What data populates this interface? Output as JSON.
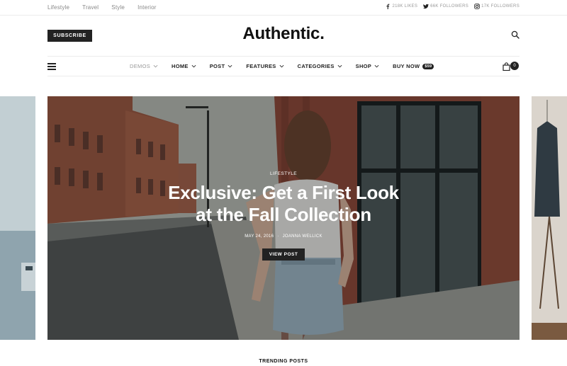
{
  "topbar": {
    "links": [
      "Lifestyle",
      "Travel",
      "Style",
      "Interior"
    ],
    "social": [
      {
        "icon": "facebook-icon",
        "label": "218K LIKES"
      },
      {
        "icon": "twitter-icon",
        "label": "66K FOLLOWERS"
      },
      {
        "icon": "instagram-icon",
        "label": "17K FOLLOWERS"
      }
    ]
  },
  "header": {
    "subscribe_label": "Subscribe",
    "logo": "Authentic."
  },
  "nav": {
    "items": [
      {
        "label": "Demos",
        "muted": true
      },
      {
        "label": "Home"
      },
      {
        "label": "Post"
      },
      {
        "label": "Features"
      },
      {
        "label": "Categories"
      },
      {
        "label": "Shop"
      }
    ],
    "buy_now_label": "Buy Now",
    "buy_now_badge": "$59",
    "cart_count": "0"
  },
  "hero": {
    "category": "Lifestyle",
    "title_line1": "Exclusive: Get a First Look",
    "title_line2": "at the Fall Collection",
    "date": "May 24, 2016",
    "author": "Joanna Wellick",
    "button_label": "View Post"
  },
  "section": {
    "trending_title": "Trending Posts"
  }
}
